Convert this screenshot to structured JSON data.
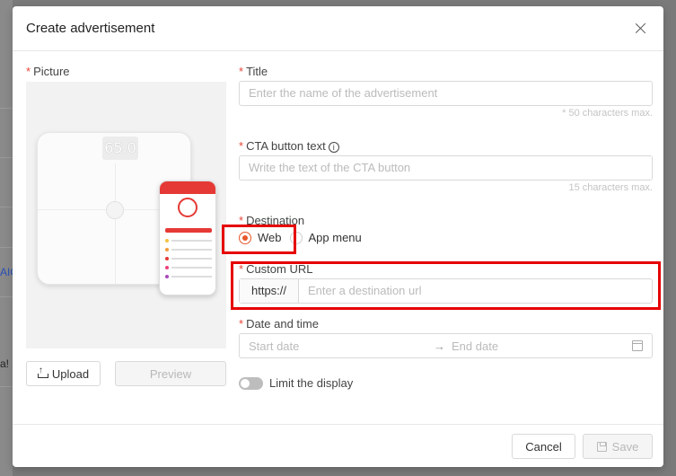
{
  "background": {
    "fragments": [
      "AIC",
      "a!"
    ]
  },
  "modal": {
    "title": "Create advertisement",
    "required_mark": "*",
    "picture": {
      "label": "Picture",
      "scale_reading": "65.0",
      "upload_label": "Upload",
      "preview_label": "Preview"
    },
    "title_field": {
      "label": "Title",
      "placeholder": "Enter the name of the advertisement",
      "hint": "* 50 characters max."
    },
    "cta_field": {
      "label": "CTA button text",
      "info_glyph": "i",
      "placeholder": "Write the text of the CTA button",
      "hint": "15 characters max."
    },
    "destination": {
      "label": "Destination",
      "options": [
        {
          "label": "Web",
          "checked": true
        },
        {
          "label": "App menu",
          "checked": false
        }
      ]
    },
    "custom_url": {
      "label": "Custom URL",
      "prefix": "https://",
      "placeholder": "Enter a destination url"
    },
    "date_time": {
      "label": "Date and time",
      "start_placeholder": "Start date",
      "arrow": "→",
      "end_placeholder": "End date"
    },
    "limit_display": {
      "label": "Limit the display",
      "enabled": false
    },
    "footer": {
      "cancel_label": "Cancel",
      "save_label": "Save"
    }
  },
  "colors": {
    "accent": "#e8552b",
    "required": "#e8473a",
    "highlight": "#e60000"
  }
}
